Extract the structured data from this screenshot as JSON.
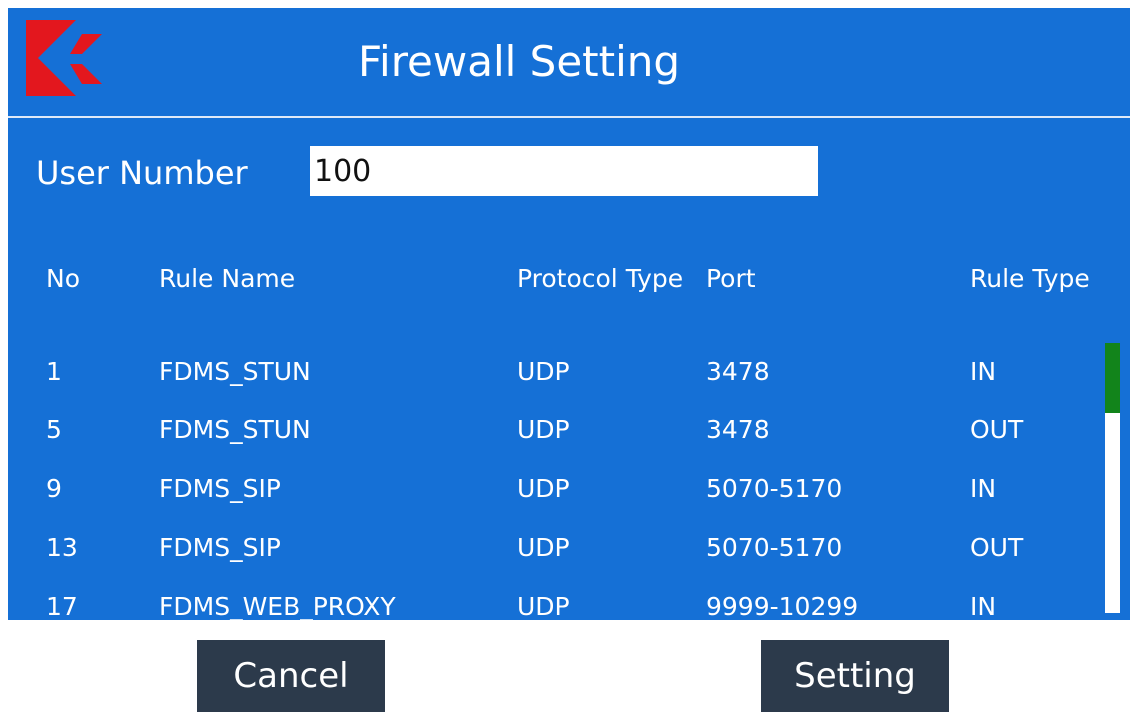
{
  "header": {
    "title": "Firewall Setting",
    "logo_icon": "red-k-logo-icon",
    "logo_color": "#e3171e",
    "background": "#1570d6"
  },
  "user_number": {
    "label": "User Number",
    "value": "100"
  },
  "table": {
    "columns": [
      "No",
      "Rule Name",
      "Protocol Type",
      "Port",
      "Rule Type"
    ],
    "rows": [
      [
        "1",
        "FDMS_STUN",
        "UDP",
        "3478",
        "IN"
      ],
      [
        "5",
        "FDMS_STUN",
        "UDP",
        "3478",
        "OUT"
      ],
      [
        "9",
        "FDMS_SIP",
        "UDP",
        "5070-5170",
        "IN"
      ],
      [
        "13",
        "FDMS_SIP",
        "UDP",
        "5070-5170",
        "OUT"
      ],
      [
        "17",
        "FDMS_WEB_PROXY",
        "UDP",
        "9999-10299",
        "IN"
      ]
    ],
    "scrollbar_thumb_color": "#12841b",
    "scroll_position": 0
  },
  "footer": {
    "cancel_label": "Cancel",
    "setting_label": "Setting",
    "button_color": "#2c3a4b"
  }
}
